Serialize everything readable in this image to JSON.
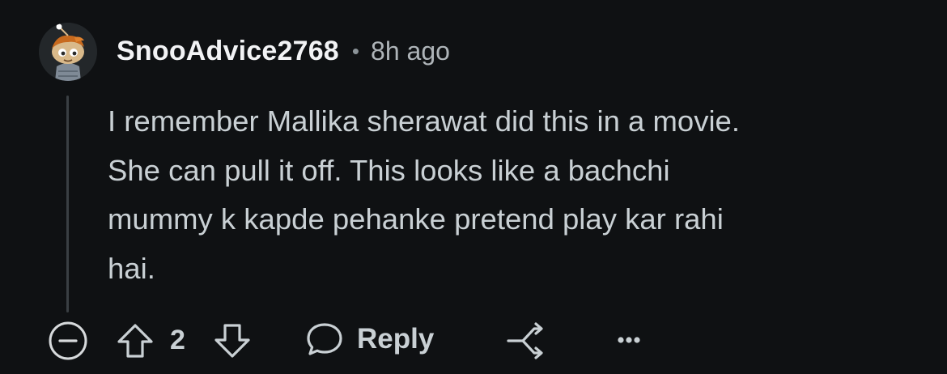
{
  "comment": {
    "username": "SnooAdvice2768",
    "separator": "•",
    "time_ago": "8h ago",
    "body": "I remember Mallika sherawat did this in a movie.\nShe can pull it off. This looks like a bachchi\nmummy k kapde pehanke pretend play kar rahi\nhai."
  },
  "actions": {
    "vote_count": "2",
    "reply_label": "Reply",
    "collapse_icon": "collapse-minus-icon",
    "upvote_icon": "upvote-arrow-icon",
    "downvote_icon": "downvote-arrow-icon",
    "reply_icon": "speech-bubble-icon",
    "share_icon": "share-icon",
    "more_icon": "more-options-icon"
  },
  "colors": {
    "background": "#0f1113",
    "username": "#f2f3f5",
    "text": "#c9d0d4",
    "muted": "#aeb4b8",
    "thread_line": "#3a3f43"
  }
}
